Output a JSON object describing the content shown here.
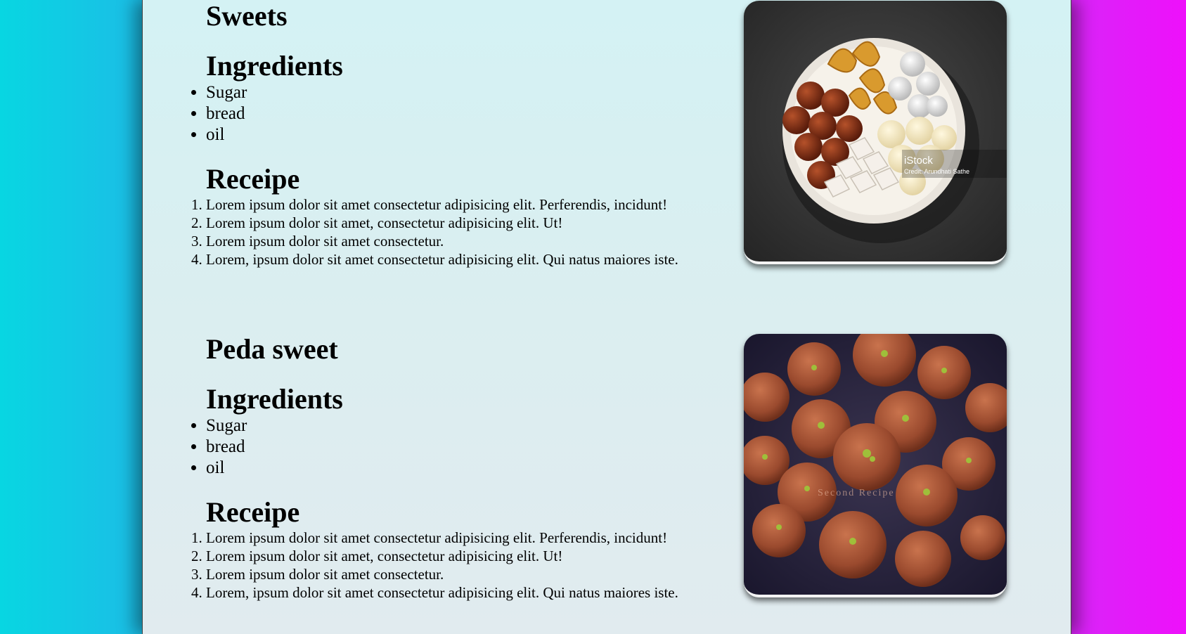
{
  "recipes": [
    {
      "title": "Sweets",
      "ingredients_heading": "Ingredients",
      "ingredients": [
        "Sugar",
        "bread",
        "oil"
      ],
      "recipe_heading": "Receipe",
      "steps": [
        "Lorem ipsum dolor sit amet consectetur adipisicing elit. Perferendis, incidunt!",
        "Lorem ipsum dolor sit amet, consectetur adipisicing elit. Ut!",
        "Lorem ipsum dolor sit amet consectetur.",
        "Lorem, ipsum dolor sit amet consectetur adipisicing elit. Qui natus maiores iste."
      ],
      "image_watermark": "iStock",
      "image_credit": "Credit: Arundhati Sathe"
    },
    {
      "title": "Peda sweet",
      "ingredients_heading": "Ingredients",
      "ingredients": [
        "Sugar",
        "bread",
        "oil"
      ],
      "recipe_heading": "Receipe",
      "steps": [
        "Lorem ipsum dolor sit amet consectetur adipisicing elit. Perferendis, incidunt!",
        "Lorem ipsum dolor sit amet, consectetur adipisicing elit. Ut!",
        "Lorem ipsum dolor sit amet consectetur.",
        "Lorem, ipsum dolor sit amet consectetur adipisicing elit. Qui natus maiores iste."
      ],
      "image_watermark": "Second Recipe"
    }
  ]
}
